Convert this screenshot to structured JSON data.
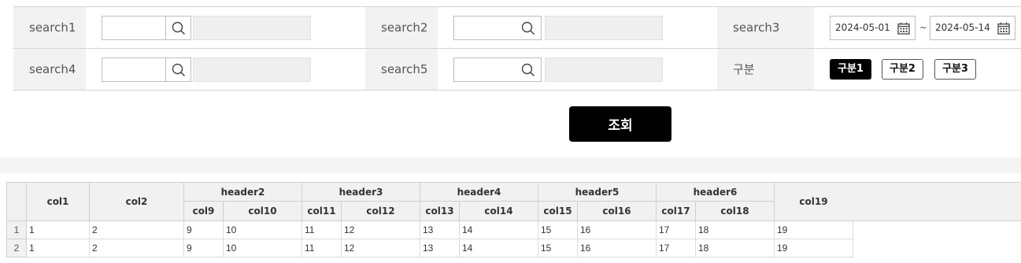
{
  "search": {
    "row1": {
      "label1": "search1",
      "label2": "search2",
      "label3": "search3",
      "date_from": "2024-05-01",
      "date_sep": "~",
      "date_to": "2024-05-14"
    },
    "row2": {
      "label1": "search4",
      "label2": "search5",
      "label3": "구분",
      "segments": [
        "구분1",
        "구분2",
        "구분3"
      ],
      "active_segment": "구분1"
    },
    "query_label": "조회"
  },
  "grid": {
    "header": {
      "col1": "col1",
      "col2": "col2",
      "groups": [
        {
          "label": "header2",
          "cols": [
            "col9",
            "col10"
          ]
        },
        {
          "label": "header3",
          "cols": [
            "col11",
            "col12"
          ]
        },
        {
          "label": "header4",
          "cols": [
            "col13",
            "col14"
          ]
        },
        {
          "label": "header5",
          "cols": [
            "col15",
            "col16"
          ]
        },
        {
          "label": "header6",
          "cols": [
            "col17",
            "col18"
          ]
        }
      ],
      "col19": "col19"
    },
    "rows": [
      {
        "num": "1",
        "cells": [
          "1",
          "2",
          "9",
          "10",
          "11",
          "12",
          "13",
          "14",
          "15",
          "16",
          "17",
          "18",
          "19"
        ]
      },
      {
        "num": "2",
        "cells": [
          "1",
          "2",
          "9",
          "10",
          "11",
          "12",
          "13",
          "14",
          "15",
          "16",
          "17",
          "18",
          "19"
        ]
      }
    ]
  },
  "icons": [
    "search-icon",
    "calendar-icon"
  ],
  "colors": {
    "primary_button": "#000000",
    "label_bg": "#f2f2f2",
    "grid_header_bg": "#f1f1f1"
  }
}
